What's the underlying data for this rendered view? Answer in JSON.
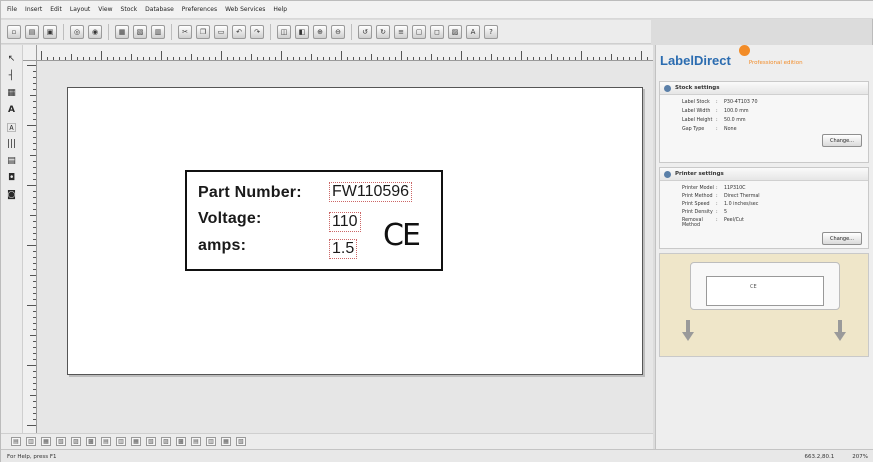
{
  "menubar": {
    "items": [
      "File",
      "Insert",
      "Edit",
      "Layout",
      "View",
      "Stock",
      "Database",
      "Preferences",
      "Web Services",
      "Help"
    ]
  },
  "toolbar": {
    "help_label": "?"
  },
  "label": {
    "part_number_label": "Part Number:",
    "part_number_value": "FW110596",
    "voltage_label": "Voltage:",
    "voltage_value": "110",
    "amps_label": "amps:",
    "amps_value": "1.5",
    "ce_mark": "CE"
  },
  "right_panel": {
    "brand": "LabelDirect",
    "edition": "Professional edition",
    "stock_settings": {
      "title": "Stock settings",
      "rows": [
        {
          "key": "Label Stock",
          "value": "P30-4T103 70"
        },
        {
          "key": "Label Width",
          "value": "100.0   mm"
        },
        {
          "key": "Label Height",
          "value": "50.0    mm"
        },
        {
          "key": "Gap Type",
          "value": "None"
        }
      ],
      "change_label": "Change..."
    },
    "printer_settings": {
      "title": "Printer settings",
      "rows": [
        {
          "key": "Printer Model",
          "value": "11P310C"
        },
        {
          "key": "Print Method",
          "value": "Direct Thermal"
        },
        {
          "key": "Print Speed",
          "value": "1.0    inches/sec"
        },
        {
          "key": "Print Density",
          "value": "5"
        },
        {
          "key": "Removal Method",
          "value": "Peel/Cut"
        }
      ],
      "change_label": "Change..."
    },
    "preview_text": "CE"
  },
  "status": {
    "left": "For Help, press F1",
    "position": "663.2,80.1",
    "zoom": "207%"
  },
  "colors": {
    "brand_blue": "#2b6cb0",
    "brand_orange": "#f28c28",
    "preview_bg": "#efe6c9"
  }
}
